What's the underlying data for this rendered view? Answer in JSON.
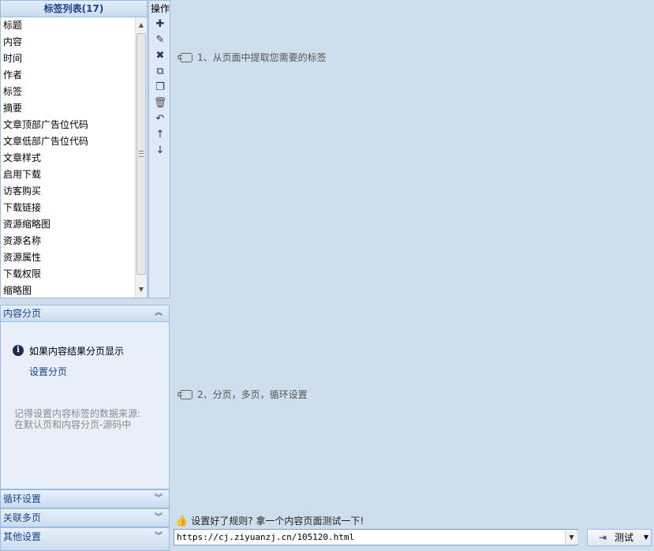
{
  "tag_panel": {
    "title": "标签列表(17)",
    "items": [
      "标题",
      "内容",
      "时间",
      "作者",
      "标签",
      "摘要",
      "文章顶部广告位代码",
      "文章低部广告位代码",
      "文章样式",
      "启用下载",
      "访客购买",
      "下载链接",
      "资源缩略图",
      "资源名称",
      "资源属性",
      "下载权限",
      "缩略图"
    ]
  },
  "operations": {
    "label": "操作",
    "icons": [
      "add-icon",
      "edit-icon",
      "delete-icon",
      "copy-icon",
      "paste-icon",
      "trash-icon",
      "undo-icon",
      "move-up-icon",
      "move-down-icon"
    ]
  },
  "pagination_panel": {
    "title": "内容分页",
    "info": "如果内容结果分页显示",
    "link": "设置分页",
    "note_line1": "记得设置内容标签的数据来源:",
    "note_line2": "在默认页和内容分页-源码中"
  },
  "collapsed_panels": [
    "循环设置",
    "关联多页",
    "其他设置"
  ],
  "steps": {
    "step1": "1、从页面中提取您需要的标签",
    "step2": "2、分页，多页，循环设置"
  },
  "test": {
    "hint": "设置好了规则? 拿一个内容页面测试一下!",
    "url": "https://cj.ziyuanzj.cn/105120.html",
    "button": "测试"
  }
}
